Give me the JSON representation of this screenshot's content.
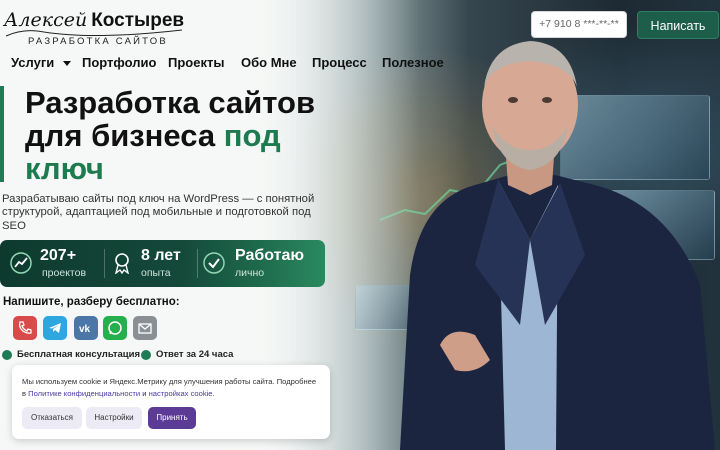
{
  "header": {
    "logo_first": "Алексей",
    "logo_last": "Костырев",
    "logo_sub": "РАЗРАБОТКА САЙТОВ",
    "phone": "+7 910 8 ***-**-**",
    "write_button": "Написать"
  },
  "nav": {
    "items": [
      {
        "label": "Услуги",
        "has_dropdown": true
      },
      {
        "label": "Портфолио"
      },
      {
        "label": "Проекты"
      },
      {
        "label": "Обо Мне"
      },
      {
        "label": "Процесс"
      },
      {
        "label": "Полезное"
      }
    ]
  },
  "hero": {
    "title_line1": "Разработка сайтов",
    "title_line2_plain": "для бизнеса ",
    "title_line2_accent": "под",
    "title_line3_accent": "ключ",
    "description": "Разрабатываю сайты под ключ на WordPress — с понятной структурой, адаптацией под мобильные и подготовкой под SEO"
  },
  "stats": [
    {
      "value": "207+",
      "label": "проектов",
      "icon": "growth-chart-icon"
    },
    {
      "value": "8 лет",
      "label": "опыта",
      "icon": "award-ribbon-icon"
    },
    {
      "value": "Работаю",
      "label": "лично",
      "icon": "check-shield-icon"
    }
  ],
  "contact": {
    "title": "Напишите, разберу бесплатно:",
    "channels": [
      {
        "name": "phone",
        "icon": "phone-icon",
        "color": "#d94a4a"
      },
      {
        "name": "telegram",
        "icon": "telegram-icon",
        "color": "#2ea6e0"
      },
      {
        "name": "vk",
        "icon": "vk-icon",
        "color": "#4a76a8"
      },
      {
        "name": "whatsapp",
        "icon": "whatsapp-icon",
        "color": "#25b04c"
      },
      {
        "name": "email",
        "icon": "mail-icon",
        "color": "#8a8f96"
      }
    ],
    "features": [
      "Бесплатная консультация",
      "Ответ за 24 часа"
    ]
  },
  "cookie": {
    "text_before": "Мы используем cookie и Яндекс.Метрику для улучшения работы сайта. Подробнее в ",
    "link_privacy": "Политике конфиденциальности",
    "text_and": " и ",
    "link_settings": "настройках cookie",
    "text_end": ".",
    "refuse": "Отказаться",
    "settings": "Настройки",
    "accept": "Принять"
  },
  "colors": {
    "brand_green": "#1c5e4a",
    "accent_green": "#1e7a4f",
    "accept_purple": "#5b3b96"
  }
}
